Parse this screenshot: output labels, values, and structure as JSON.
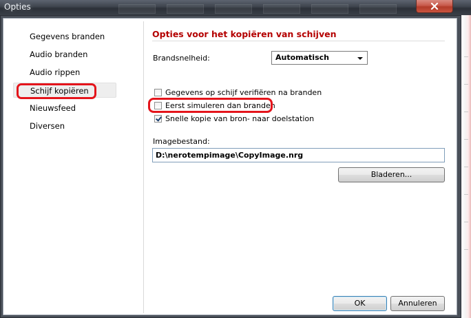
{
  "window": {
    "title": "Opties",
    "close_icon": "close-icon"
  },
  "sidebar": {
    "items": [
      {
        "label": "Gegevens branden"
      },
      {
        "label": "Audio branden"
      },
      {
        "label": "Audio rippen"
      },
      {
        "label": "Schijf kopiëren",
        "selected": true
      },
      {
        "label": "Nieuwsfeed"
      },
      {
        "label": "Diversen"
      }
    ]
  },
  "content": {
    "heading": "Opties voor het kopiëren van schijven",
    "speed_label": "Brandsnelheid:",
    "speed_value": "Automatisch",
    "checkboxes": [
      {
        "label": "Gegevens op schijf verifiëren na branden",
        "checked": false
      },
      {
        "label": "Eerst simuleren dan branden",
        "checked": false
      },
      {
        "label": "Snelle kopie van bron- naar doelstation",
        "checked": true
      }
    ],
    "image_file_label": "Imagebestand:",
    "image_file_value": "D:\\nerotempimage\\CopyImage.nrg",
    "browse_button": "Bladeren..."
  },
  "footer": {
    "ok_button": "OK",
    "cancel_button": "Annuleren"
  },
  "colors": {
    "heading": "#b40000",
    "annotation_highlight": "#e4141b",
    "titlebar": "#3d434c"
  }
}
